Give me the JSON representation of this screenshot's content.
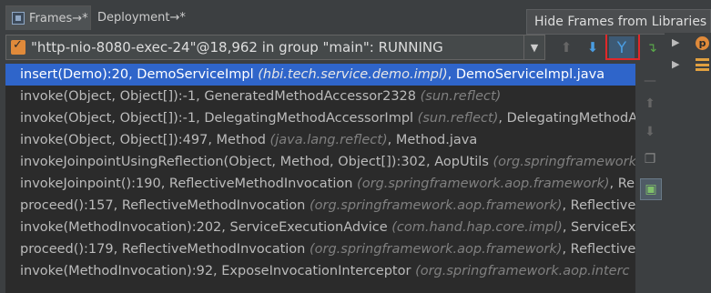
{
  "tabs": [
    {
      "label": "Frames",
      "suffix": "→*"
    },
    {
      "label": "Deployment",
      "suffix": "→*"
    }
  ],
  "tooltip": "Hide Frames from Libraries",
  "thread": {
    "label": "\"http-nio-8080-exec-24\"@18,962 in group \"main\": RUNNING",
    "dropdown_glyph": "▼"
  },
  "toolbar": {
    "up_glyph": "⬆",
    "down_glyph": "⬇",
    "filter_glyph": "Y",
    "export_glyph": "↴"
  },
  "frames": [
    {
      "method": "insert(Demo):20, DemoServiceImpl ",
      "pkg": "(hbi.tech.service.demo.impl)",
      "file": ", DemoServiceImpl.java"
    },
    {
      "method": "invoke(Object, Object[]):-1, GeneratedMethodAccessor2328 ",
      "pkg": "(sun.reflect)",
      "file": ""
    },
    {
      "method": "invoke(Object, Object[]):-1, DelegatingMethodAccessorImpl ",
      "pkg": "(sun.reflect)",
      "file": ", DelegatingMethodA"
    },
    {
      "method": "invoke(Object, Object[]):497, Method ",
      "pkg": "(java.lang.reflect)",
      "file": ", Method.java"
    },
    {
      "method": "invokeJoinpointUsingReflection(Object, Method, Object[]):302, AopUtils ",
      "pkg": "(org.springframework",
      "file": ""
    },
    {
      "method": "invokeJoinpoint():190, ReflectiveMethodInvocation ",
      "pkg": "(org.springframework.aop.framework)",
      "file": ", Re"
    },
    {
      "method": "proceed():157, ReflectiveMethodInvocation ",
      "pkg": "(org.springframework.aop.framework)",
      "file": ", Reflective"
    },
    {
      "method": "invoke(MethodInvocation):202, ServiceExecutionAdvice ",
      "pkg": "(com.hand.hap.core.impl)",
      "file": ", ServiceExe"
    },
    {
      "method": "proceed():179, ReflectiveMethodInvocation ",
      "pkg": "(org.springframework.aop.framework)",
      "file": ", Reflective"
    },
    {
      "method": "invoke(MethodInvocation):92, ExposeInvocationInterceptor ",
      "pkg": "(org.springframework.aop.interc",
      "file": ""
    }
  ],
  "selected_index": 0,
  "right_pane": {
    "expand_glyph": "▶",
    "badge": "p"
  },
  "colors": {
    "selection": "#2f65ca",
    "highlight_box": "#e0282a",
    "accent_blue": "#4a9de2"
  }
}
